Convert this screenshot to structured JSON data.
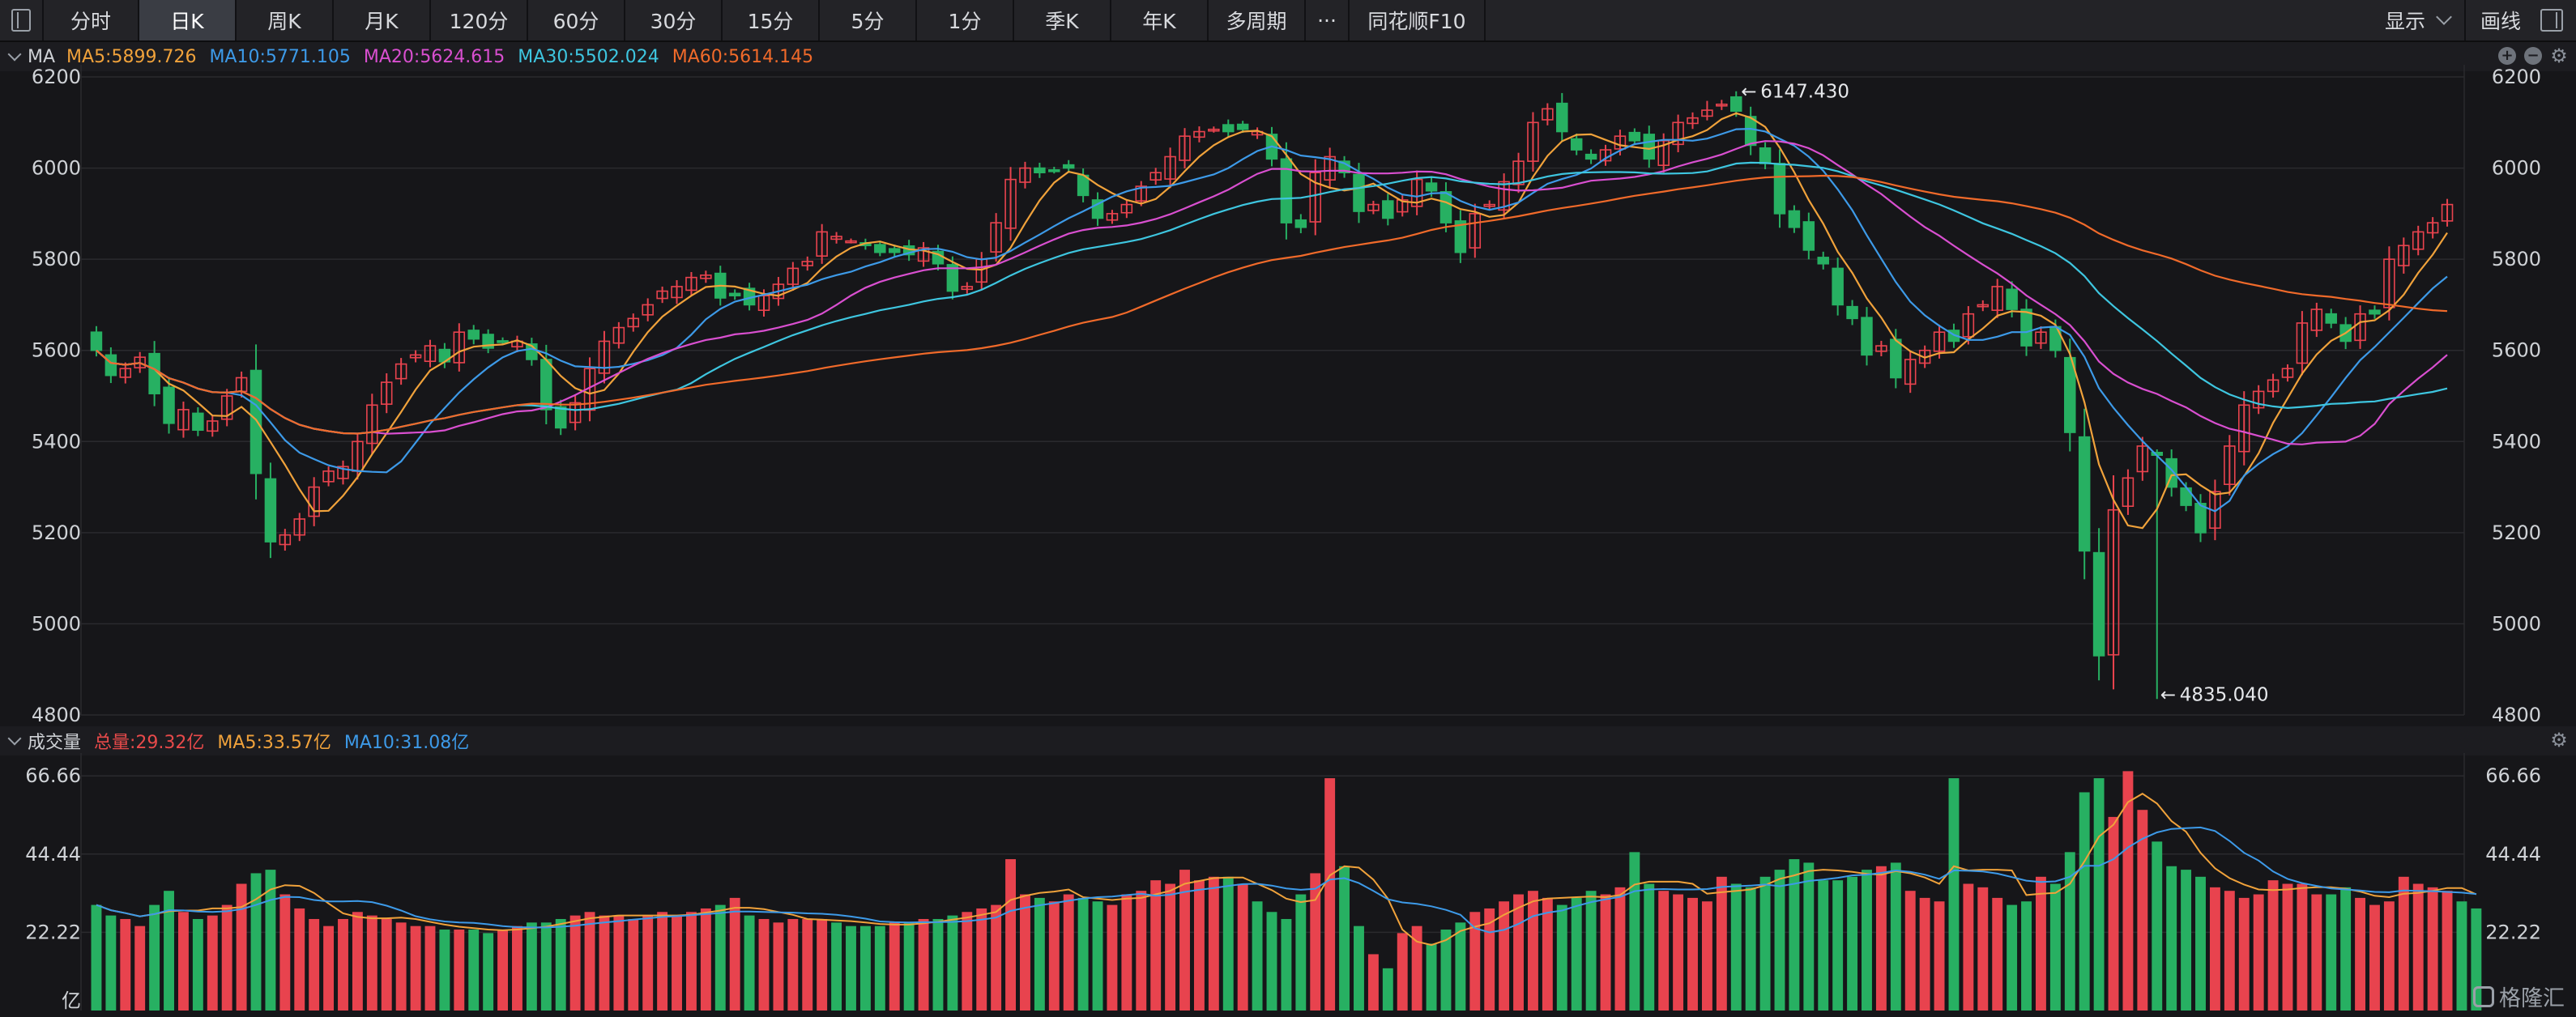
{
  "toolbar": {
    "tabs": [
      {
        "label": "分时",
        "w": 116
      },
      {
        "label": "日K",
        "w": 118,
        "active": true
      },
      {
        "label": "周K",
        "w": 118
      },
      {
        "label": "月K",
        "w": 118
      },
      {
        "label": "120分",
        "w": 118
      },
      {
        "label": "60分",
        "w": 118
      },
      {
        "label": "30分",
        "w": 118
      },
      {
        "label": "15分",
        "w": 118
      },
      {
        "label": "5分",
        "w": 118
      },
      {
        "label": "1分",
        "w": 118
      },
      {
        "label": "季K",
        "w": 118
      },
      {
        "label": "年K",
        "w": 118
      },
      {
        "label": "多周期",
        "w": 118
      },
      {
        "label": "···",
        "w": 52
      },
      {
        "label": "同花顺F10",
        "w": 166
      }
    ],
    "display_label": "显示",
    "draw_label": "画线"
  },
  "ma_legend": {
    "label": "MA",
    "items": [
      {
        "text": "MA5:5899.726",
        "color": "#f0a23b"
      },
      {
        "text": "MA10:5771.105",
        "color": "#3d9ae8"
      },
      {
        "text": "MA20:5624.615",
        "color": "#d94fd0"
      },
      {
        "text": "MA30:5502.024",
        "color": "#3ec6e0"
      },
      {
        "text": "MA60:5614.145",
        "color": "#f06a2a"
      }
    ]
  },
  "vol_legend": {
    "label": "成交量",
    "items": [
      {
        "text": "总量:29.32亿",
        "color": "#e84a4a"
      },
      {
        "text": "MA5:33.57亿",
        "color": "#f0a23b"
      },
      {
        "text": "MA10:31.08亿",
        "color": "#3d9ae8"
      }
    ]
  },
  "colors": {
    "up": "#e8434e",
    "down": "#27b062",
    "grid": "#2a2a2e",
    "axis_text": "#cfd2d6"
  },
  "annotations": {
    "high": "6147.430",
    "low": "4835.040"
  },
  "chart_data": [
    {
      "type": "candlestick",
      "y_ticks": [
        6200,
        6000,
        5800,
        5600,
        5400,
        5200,
        5000,
        4800
      ],
      "ylim": [
        4800,
        6200
      ],
      "closes": [
        5600,
        5545,
        5560,
        5585,
        5505,
        5440,
        5470,
        5425,
        5445,
        5500,
        5540,
        5330,
        5180,
        5195,
        5230,
        5300,
        5335,
        5345,
        5400,
        5480,
        5530,
        5570,
        5590,
        5610,
        5575,
        5640,
        5625,
        5605,
        5620,
        5620,
        5580,
        5470,
        5430,
        5485,
        5560,
        5620,
        5650,
        5670,
        5700,
        5730,
        5740,
        5760,
        5765,
        5715,
        5720,
        5700,
        5720,
        5745,
        5780,
        5795,
        5860,
        5850,
        5840,
        5830,
        5815,
        5815,
        5810,
        5825,
        5790,
        5730,
        5740,
        5800,
        5880,
        5975,
        6000,
        5990,
        5995,
        6000,
        5940,
        5890,
        5900,
        5920,
        5960,
        5990,
        6025,
        6070,
        6080,
        6085,
        6080,
        6085,
        6080,
        6020,
        5880,
        5870,
        5990,
        6025,
        5990,
        5905,
        5920,
        5890,
        5930,
        5975,
        5950,
        5880,
        5815,
        5900,
        5920,
        5970,
        6015,
        6100,
        6130,
        6080,
        6040,
        6020,
        6040,
        6070,
        6060,
        6020,
        6060,
        6100,
        6110,
        6127,
        6140,
        6125,
        6050,
        6010,
        5900,
        5870,
        5820,
        5790,
        5700,
        5670,
        5590,
        5610,
        5540,
        5580,
        5600,
        5640,
        5620,
        5680,
        5700,
        5740,
        5690,
        5610,
        5640,
        5600,
        5420,
        5160,
        4930,
        5250,
        5320,
        5390,
        5370,
        5300,
        5260,
        5200,
        5290,
        5390,
        5480,
        5510,
        5535,
        5560,
        5660,
        5690,
        5660,
        5620,
        5680,
        5680,
        5800,
        5830,
        5860,
        5880,
        5920
      ],
      "volumes": [
        30,
        27,
        26,
        24,
        30,
        34,
        28,
        26,
        27,
        30,
        36,
        39,
        40,
        33,
        29,
        26,
        24,
        26,
        28,
        27,
        26,
        25,
        24,
        24,
        23,
        23,
        23,
        22,
        23,
        24,
        25,
        25,
        26,
        27,
        28,
        27,
        27,
        26,
        27,
        28,
        27,
        28,
        29,
        30,
        32,
        27,
        26,
        25,
        26,
        26,
        26,
        25,
        24,
        24,
        24,
        25,
        25,
        26,
        26,
        27,
        28,
        29,
        30,
        43,
        33,
        32,
        31,
        33,
        32,
        31,
        30,
        33,
        34,
        37,
        36,
        40,
        37,
        38,
        38,
        36,
        31,
        28,
        26,
        33,
        39,
        66,
        41,
        24,
        16,
        12,
        22,
        24,
        19,
        23,
        25,
        28,
        29,
        31,
        33,
        34,
        32,
        30,
        32,
        34,
        33,
        35,
        45,
        36,
        34,
        33,
        32,
        31,
        38,
        36,
        35,
        38,
        40,
        43,
        42,
        37,
        37,
        38,
        40,
        41,
        42,
        34,
        32,
        31,
        66,
        36,
        35,
        32,
        30,
        31,
        38,
        36,
        45,
        62,
        66,
        55,
        68,
        57,
        48,
        41,
        40,
        38,
        35,
        34,
        32,
        33,
        37,
        36,
        36,
        33,
        33,
        35,
        32,
        30,
        31,
        38,
        36,
        35,
        34,
        31,
        29
      ]
    }
  ],
  "volume_axis": {
    "ticks": [
      "66.66",
      "44.44",
      "22.22"
    ],
    "unit": "亿"
  },
  "watermark": "格隆汇"
}
